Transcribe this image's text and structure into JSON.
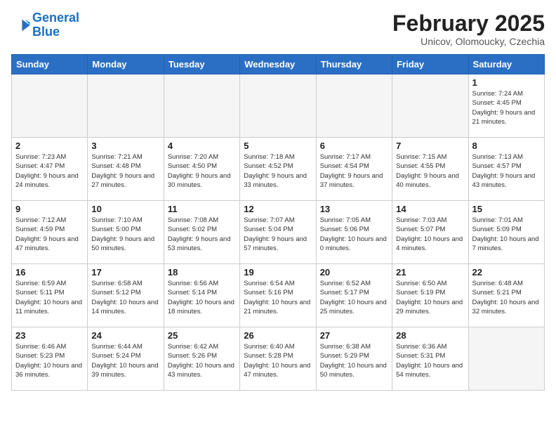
{
  "header": {
    "logo_line1": "General",
    "logo_line2": "Blue",
    "month_title": "February 2025",
    "subtitle": "Unicov, Olomoucky, Czechia"
  },
  "weekdays": [
    "Sunday",
    "Monday",
    "Tuesday",
    "Wednesday",
    "Thursday",
    "Friday",
    "Saturday"
  ],
  "weeks": [
    [
      {
        "day": "",
        "info": ""
      },
      {
        "day": "",
        "info": ""
      },
      {
        "day": "",
        "info": ""
      },
      {
        "day": "",
        "info": ""
      },
      {
        "day": "",
        "info": ""
      },
      {
        "day": "",
        "info": ""
      },
      {
        "day": "1",
        "info": "Sunrise: 7:24 AM\nSunset: 4:45 PM\nDaylight: 9 hours and 21 minutes."
      }
    ],
    [
      {
        "day": "2",
        "info": "Sunrise: 7:23 AM\nSunset: 4:47 PM\nDaylight: 9 hours and 24 minutes."
      },
      {
        "day": "3",
        "info": "Sunrise: 7:21 AM\nSunset: 4:48 PM\nDaylight: 9 hours and 27 minutes."
      },
      {
        "day": "4",
        "info": "Sunrise: 7:20 AM\nSunset: 4:50 PM\nDaylight: 9 hours and 30 minutes."
      },
      {
        "day": "5",
        "info": "Sunrise: 7:18 AM\nSunset: 4:52 PM\nDaylight: 9 hours and 33 minutes."
      },
      {
        "day": "6",
        "info": "Sunrise: 7:17 AM\nSunset: 4:54 PM\nDaylight: 9 hours and 37 minutes."
      },
      {
        "day": "7",
        "info": "Sunrise: 7:15 AM\nSunset: 4:55 PM\nDaylight: 9 hours and 40 minutes."
      },
      {
        "day": "8",
        "info": "Sunrise: 7:13 AM\nSunset: 4:57 PM\nDaylight: 9 hours and 43 minutes."
      }
    ],
    [
      {
        "day": "9",
        "info": "Sunrise: 7:12 AM\nSunset: 4:59 PM\nDaylight: 9 hours and 47 minutes."
      },
      {
        "day": "10",
        "info": "Sunrise: 7:10 AM\nSunset: 5:00 PM\nDaylight: 9 hours and 50 minutes."
      },
      {
        "day": "11",
        "info": "Sunrise: 7:08 AM\nSunset: 5:02 PM\nDaylight: 9 hours and 53 minutes."
      },
      {
        "day": "12",
        "info": "Sunrise: 7:07 AM\nSunset: 5:04 PM\nDaylight: 9 hours and 57 minutes."
      },
      {
        "day": "13",
        "info": "Sunrise: 7:05 AM\nSunset: 5:06 PM\nDaylight: 10 hours and 0 minutes."
      },
      {
        "day": "14",
        "info": "Sunrise: 7:03 AM\nSunset: 5:07 PM\nDaylight: 10 hours and 4 minutes."
      },
      {
        "day": "15",
        "info": "Sunrise: 7:01 AM\nSunset: 5:09 PM\nDaylight: 10 hours and 7 minutes."
      }
    ],
    [
      {
        "day": "16",
        "info": "Sunrise: 6:59 AM\nSunset: 5:11 PM\nDaylight: 10 hours and 11 minutes."
      },
      {
        "day": "17",
        "info": "Sunrise: 6:58 AM\nSunset: 5:12 PM\nDaylight: 10 hours and 14 minutes."
      },
      {
        "day": "18",
        "info": "Sunrise: 6:56 AM\nSunset: 5:14 PM\nDaylight: 10 hours and 18 minutes."
      },
      {
        "day": "19",
        "info": "Sunrise: 6:54 AM\nSunset: 5:16 PM\nDaylight: 10 hours and 21 minutes."
      },
      {
        "day": "20",
        "info": "Sunrise: 6:52 AM\nSunset: 5:17 PM\nDaylight: 10 hours and 25 minutes."
      },
      {
        "day": "21",
        "info": "Sunrise: 6:50 AM\nSunset: 5:19 PM\nDaylight: 10 hours and 29 minutes."
      },
      {
        "day": "22",
        "info": "Sunrise: 6:48 AM\nSunset: 5:21 PM\nDaylight: 10 hours and 32 minutes."
      }
    ],
    [
      {
        "day": "23",
        "info": "Sunrise: 6:46 AM\nSunset: 5:23 PM\nDaylight: 10 hours and 36 minutes."
      },
      {
        "day": "24",
        "info": "Sunrise: 6:44 AM\nSunset: 5:24 PM\nDaylight: 10 hours and 39 minutes."
      },
      {
        "day": "25",
        "info": "Sunrise: 6:42 AM\nSunset: 5:26 PM\nDaylight: 10 hours and 43 minutes."
      },
      {
        "day": "26",
        "info": "Sunrise: 6:40 AM\nSunset: 5:28 PM\nDaylight: 10 hours and 47 minutes."
      },
      {
        "day": "27",
        "info": "Sunrise: 6:38 AM\nSunset: 5:29 PM\nDaylight: 10 hours and 50 minutes."
      },
      {
        "day": "28",
        "info": "Sunrise: 6:36 AM\nSunset: 5:31 PM\nDaylight: 10 hours and 54 minutes."
      },
      {
        "day": "",
        "info": ""
      }
    ]
  ]
}
